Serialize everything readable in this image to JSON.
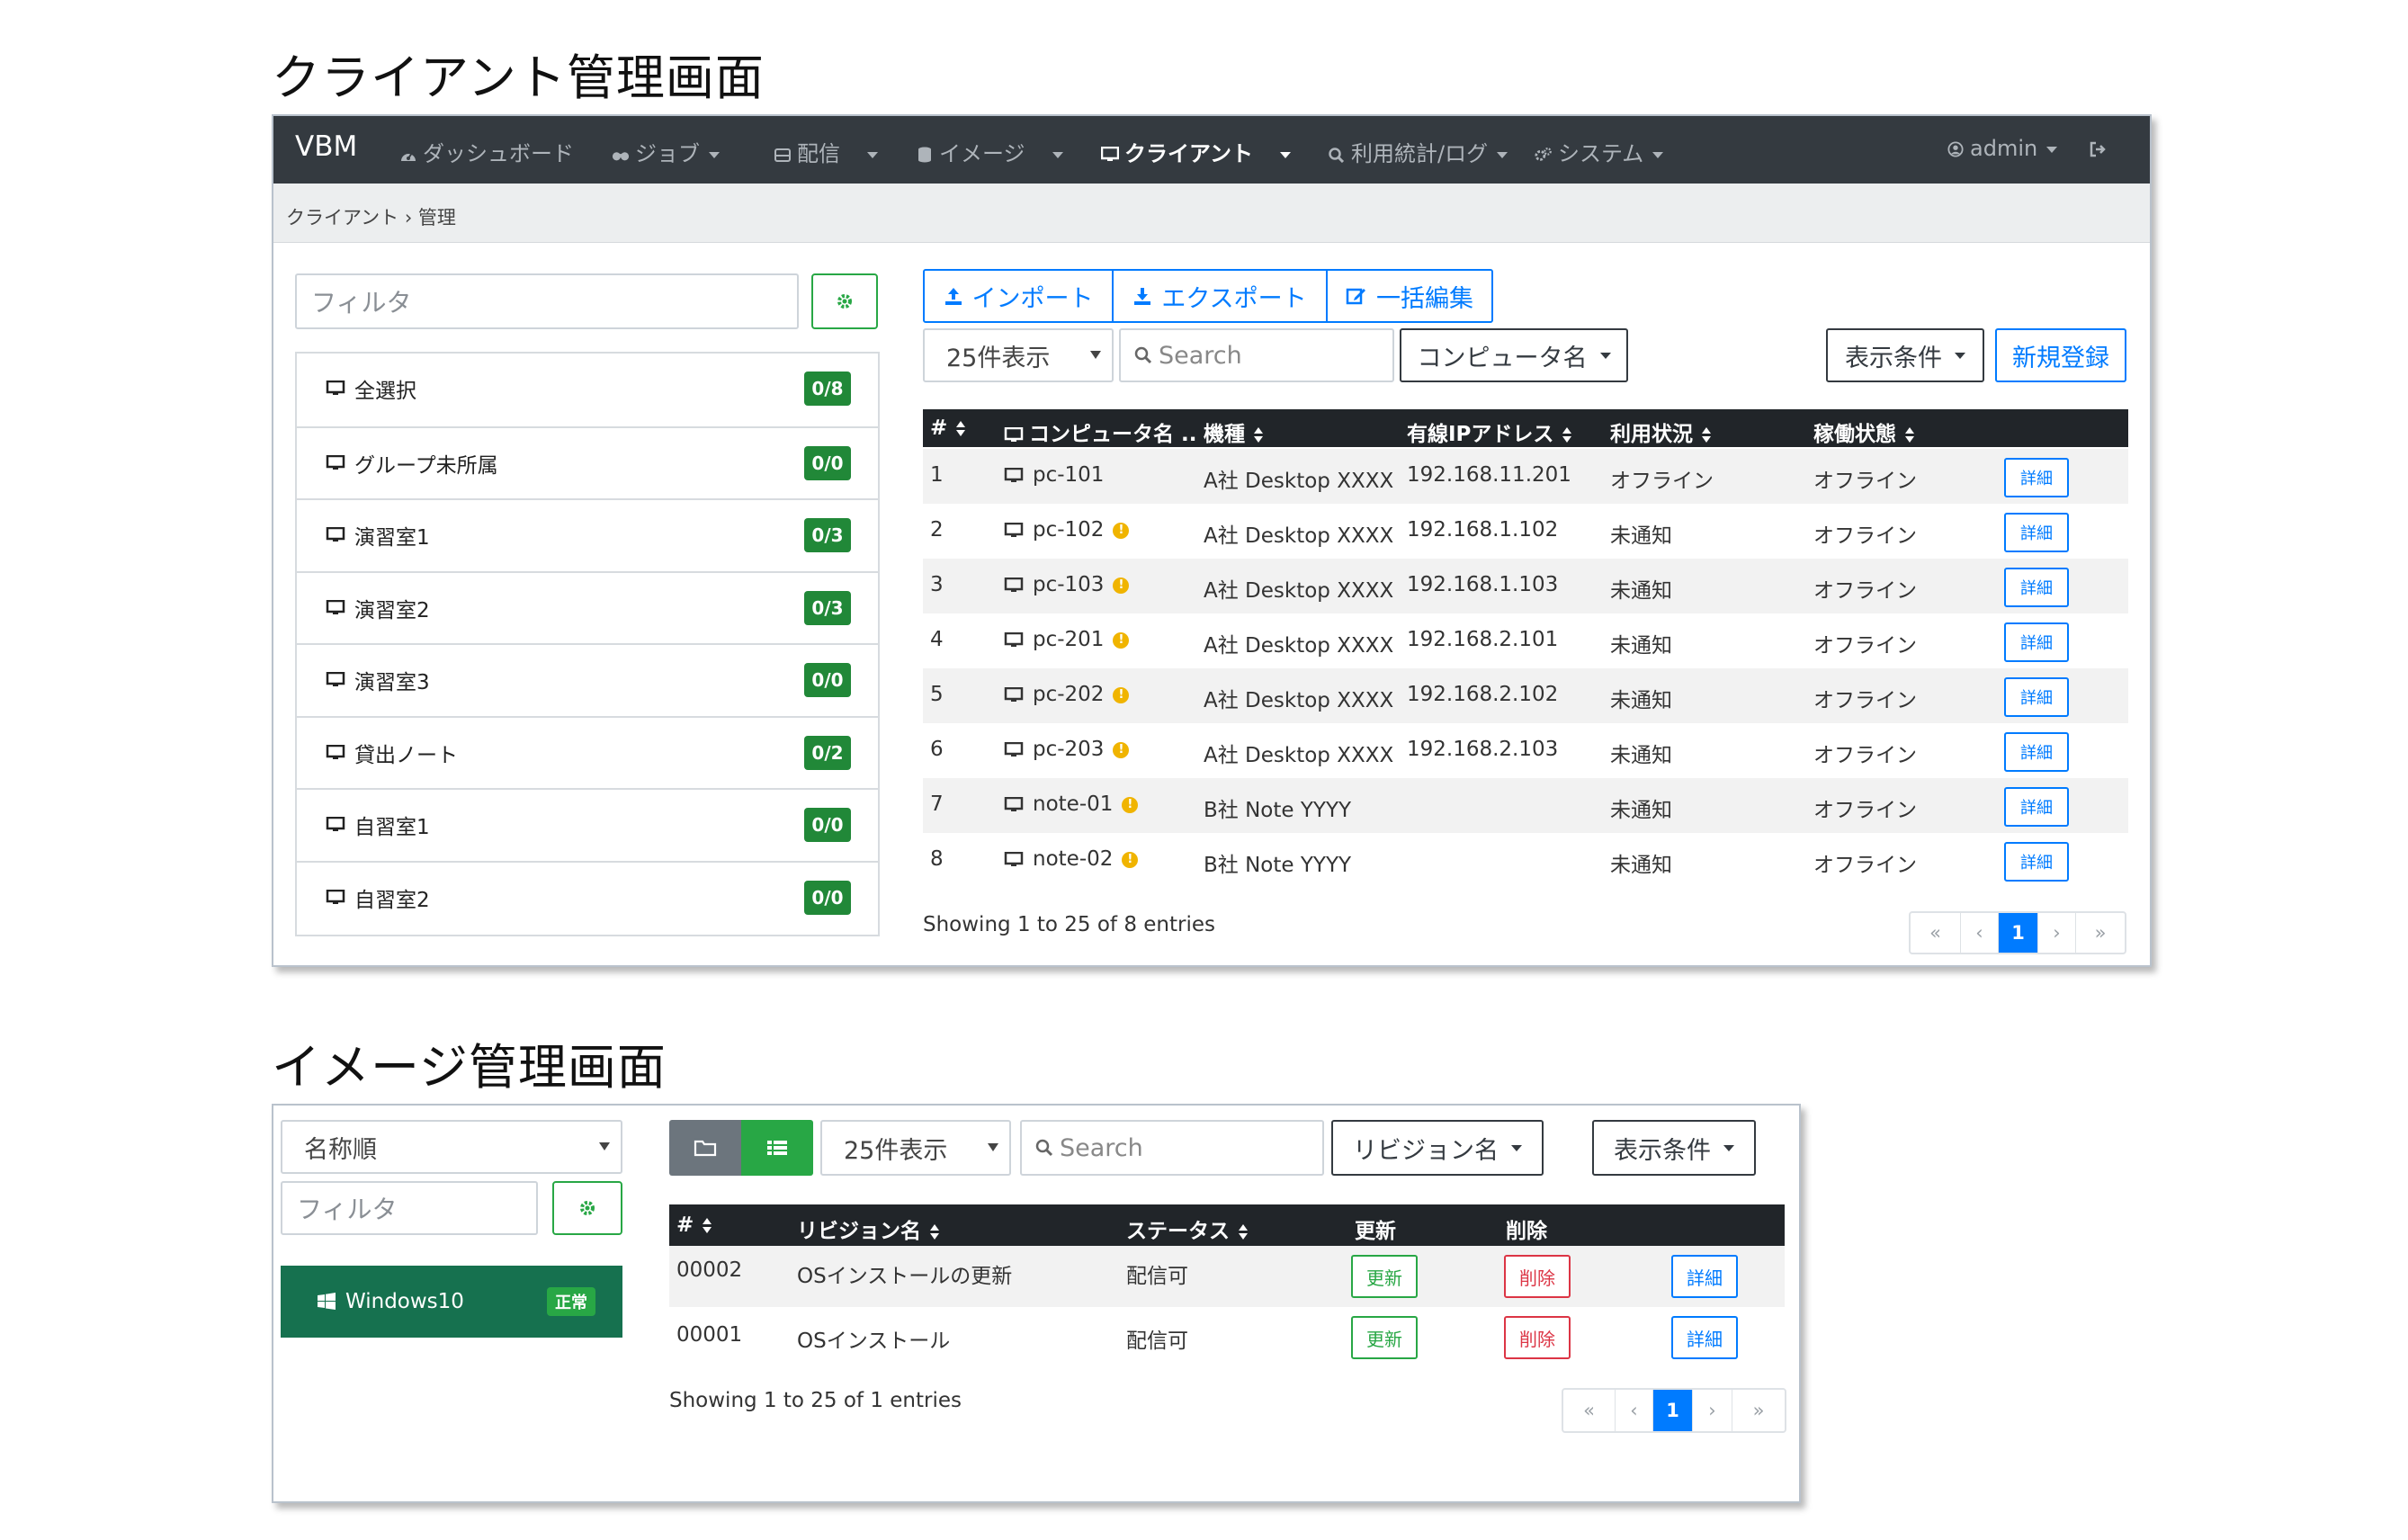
{
  "client_section": {
    "title": "クライアント管理画面",
    "navbar": {
      "brand": "VBM",
      "items": [
        {
          "label": "ダッシュボード",
          "icon": "dashboard-icon"
        },
        {
          "label": "ジョブ",
          "icon": "binoculars-icon"
        },
        {
          "label": "配信",
          "icon": "inbox-icon"
        },
        {
          "label": "イメージ",
          "icon": "database-icon"
        },
        {
          "label": "クライアント",
          "icon": "desktop-icon",
          "active": true
        },
        {
          "label": "利用統計/ログ",
          "icon": "search-icon"
        },
        {
          "label": "システム",
          "icon": "cogs-icon"
        }
      ],
      "user": "admin"
    },
    "breadcrumb": "クライアント  ›  管理",
    "filter_placeholder": "フィルタ",
    "groups": [
      {
        "label": "全選択",
        "badge": "0/8"
      },
      {
        "label": "グループ未所属",
        "badge": "0/0"
      },
      {
        "label": "演習室1",
        "badge": "0/3"
      },
      {
        "label": "演習室2",
        "badge": "0/3"
      },
      {
        "label": "演習室3",
        "badge": "0/0"
      },
      {
        "label": "貸出ノート",
        "badge": "0/2"
      },
      {
        "label": "自習室1",
        "badge": "0/0"
      },
      {
        "label": "自習室2",
        "badge": "0/0"
      }
    ],
    "toolbar": {
      "import": "インポート",
      "export": "エクスポート",
      "bulk_edit": "一括編集",
      "page_size": "25件表示",
      "search_placeholder": "Search",
      "column_select": "コンピュータ名",
      "display_filter": "表示条件",
      "new": "新規登録"
    },
    "columns": [
      "#",
      "コンピュータ名 ..",
      "機種",
      "有線IPアドレス",
      "利用状況",
      "稼働状態"
    ],
    "rows": [
      {
        "no": "1",
        "name": "pc-101",
        "warn": false,
        "model": "A社 Desktop XXXX",
        "ip": "192.168.11.201",
        "usage": "オフライン",
        "state": "オフライン"
      },
      {
        "no": "2",
        "name": "pc-102",
        "warn": true,
        "model": "A社 Desktop XXXX",
        "ip": "192.168.1.102",
        "usage": "未通知",
        "state": "オフライン"
      },
      {
        "no": "3",
        "name": "pc-103",
        "warn": true,
        "model": "A社 Desktop XXXX",
        "ip": "192.168.1.103",
        "usage": "未通知",
        "state": "オフライン"
      },
      {
        "no": "4",
        "name": "pc-201",
        "warn": true,
        "model": "A社 Desktop XXXX",
        "ip": "192.168.2.101",
        "usage": "未通知",
        "state": "オフライン"
      },
      {
        "no": "5",
        "name": "pc-202",
        "warn": true,
        "model": "A社 Desktop XXXX",
        "ip": "192.168.2.102",
        "usage": "未通知",
        "state": "オフライン"
      },
      {
        "no": "6",
        "name": "pc-203",
        "warn": true,
        "model": "A社 Desktop XXXX",
        "ip": "192.168.2.103",
        "usage": "未通知",
        "state": "オフライン"
      },
      {
        "no": "7",
        "name": "note-01",
        "warn": true,
        "model": "B社 Note YYYY",
        "ip": "",
        "usage": "未通知",
        "state": "オフライン"
      },
      {
        "no": "8",
        "name": "note-02",
        "warn": true,
        "model": "B社 Note YYYY",
        "ip": "",
        "usage": "未通知",
        "state": "オフライン"
      }
    ],
    "detail_label": "詳細",
    "info": "Showing 1 to 25 of 8 entries",
    "pager": [
      "«",
      "‹",
      "1",
      "›",
      "»"
    ]
  },
  "image_section": {
    "title": "イメージ管理画面",
    "sort_select": "名称順",
    "filter_placeholder": "フィルタ",
    "image_item": {
      "name": "Windows10",
      "badge": "正常"
    },
    "page_size": "25件表示",
    "search_placeholder": "Search",
    "column_select": "リビジョン名",
    "display_filter": "表示条件",
    "columns": [
      "#",
      "リビジョン名",
      "ステータス",
      "更新",
      "削除"
    ],
    "rows": [
      {
        "no": "00002",
        "revision": "OSインストールの更新",
        "status": "配信可"
      },
      {
        "no": "00001",
        "revision": "OSインストール",
        "status": "配信可"
      }
    ],
    "update_label": "更新",
    "delete_label": "削除",
    "detail_label": "詳細",
    "info": "Showing 1 to 25 of 1 entries",
    "pager": [
      "«",
      "‹",
      "1",
      "›",
      "»"
    ]
  },
  "colors": {
    "navbar": "#343a40",
    "primary": "#007bff",
    "success": "#28a745",
    "danger": "#dc3545",
    "image_item": "#16714f"
  }
}
